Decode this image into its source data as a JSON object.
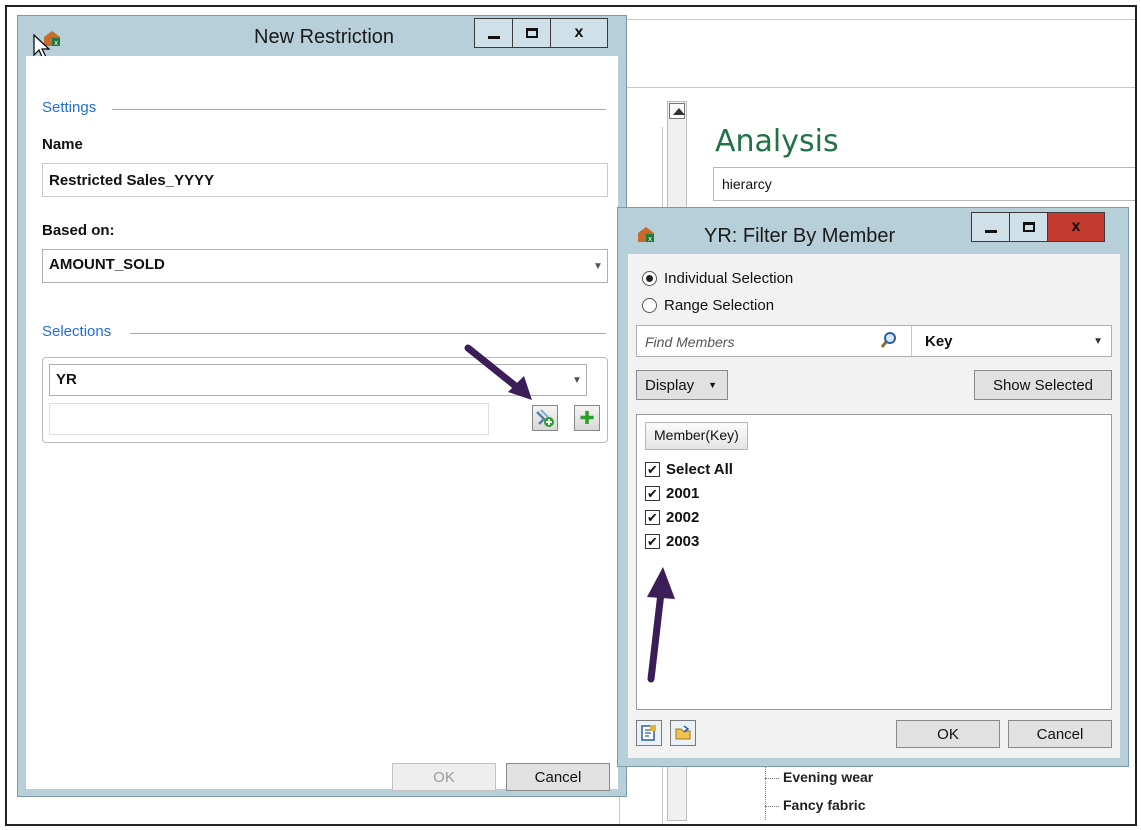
{
  "background": {
    "analysis_title": "Analysis",
    "analysis_input_value": "hierarcy",
    "tree_items": [
      "Evening wear",
      "Fancy fabric"
    ]
  },
  "new_restriction": {
    "title": "New Restriction",
    "settings_label": "Settings",
    "name_label": "Name",
    "name_value": "Restricted Sales_YYYY",
    "based_on_label": "Based on:",
    "based_on_value": "AMOUNT_SOLD",
    "selections_label": "Selections",
    "selection_value": "YR",
    "ok_label": "OK",
    "cancel_label": "Cancel"
  },
  "filter_dialog": {
    "title": "YR: Filter By Member",
    "radio_individual": "Individual Selection",
    "radio_range": "Range Selection",
    "selected_mode": "individual",
    "search_placeholder": "Find Members",
    "key_value": "Key",
    "display_label": "Display",
    "show_selected_label": "Show Selected",
    "column_header": "Member(Key)",
    "members": [
      {
        "label": "Select All",
        "checked": true
      },
      {
        "label": "2001",
        "checked": true
      },
      {
        "label": "2002",
        "checked": true
      },
      {
        "label": "2003",
        "checked": true
      }
    ],
    "ok_label": "OK",
    "cancel_label": "Cancel"
  },
  "window_buttons": {
    "minimize": "–",
    "maximize": "□",
    "close": "x"
  },
  "colors": {
    "title_bar": "#b7cfd9",
    "section_blue": "#1e6ed8",
    "close_red": "#c53a2e",
    "annotation_arrow": "#3b1e58",
    "analysis_green": "#217346"
  }
}
